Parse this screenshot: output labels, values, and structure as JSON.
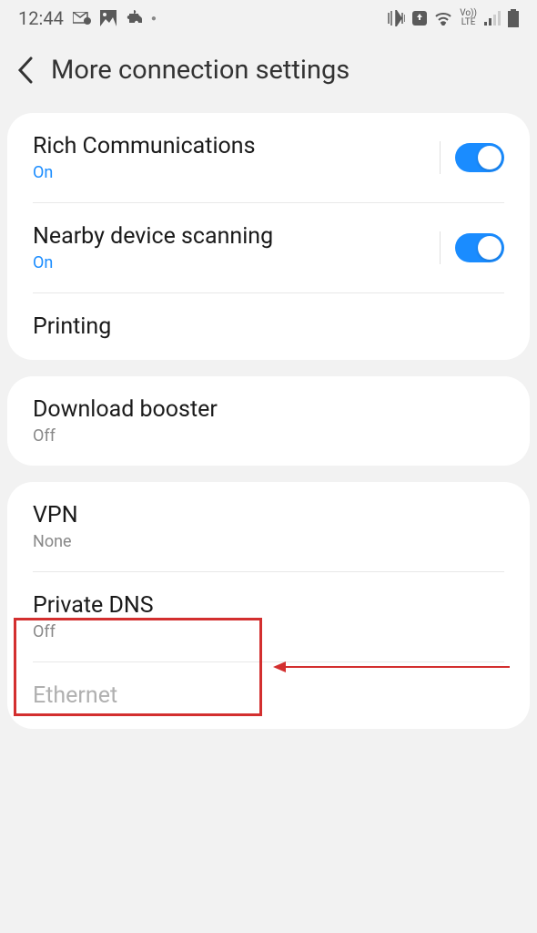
{
  "status": {
    "time": "12:44",
    "lte": "LTE",
    "vo": "Vo))"
  },
  "header": {
    "title": "More connection settings"
  },
  "group1": {
    "rich_comm": {
      "title": "Rich Communications",
      "status": "On"
    },
    "nearby": {
      "title": "Nearby device scanning",
      "status": "On"
    },
    "printing": {
      "title": "Printing"
    }
  },
  "group2": {
    "download_booster": {
      "title": "Download booster",
      "status": "Off"
    }
  },
  "group3": {
    "vpn": {
      "title": "VPN",
      "status": "None"
    },
    "private_dns": {
      "title": "Private DNS",
      "status": "Off"
    },
    "ethernet": {
      "title": "Ethernet"
    }
  }
}
